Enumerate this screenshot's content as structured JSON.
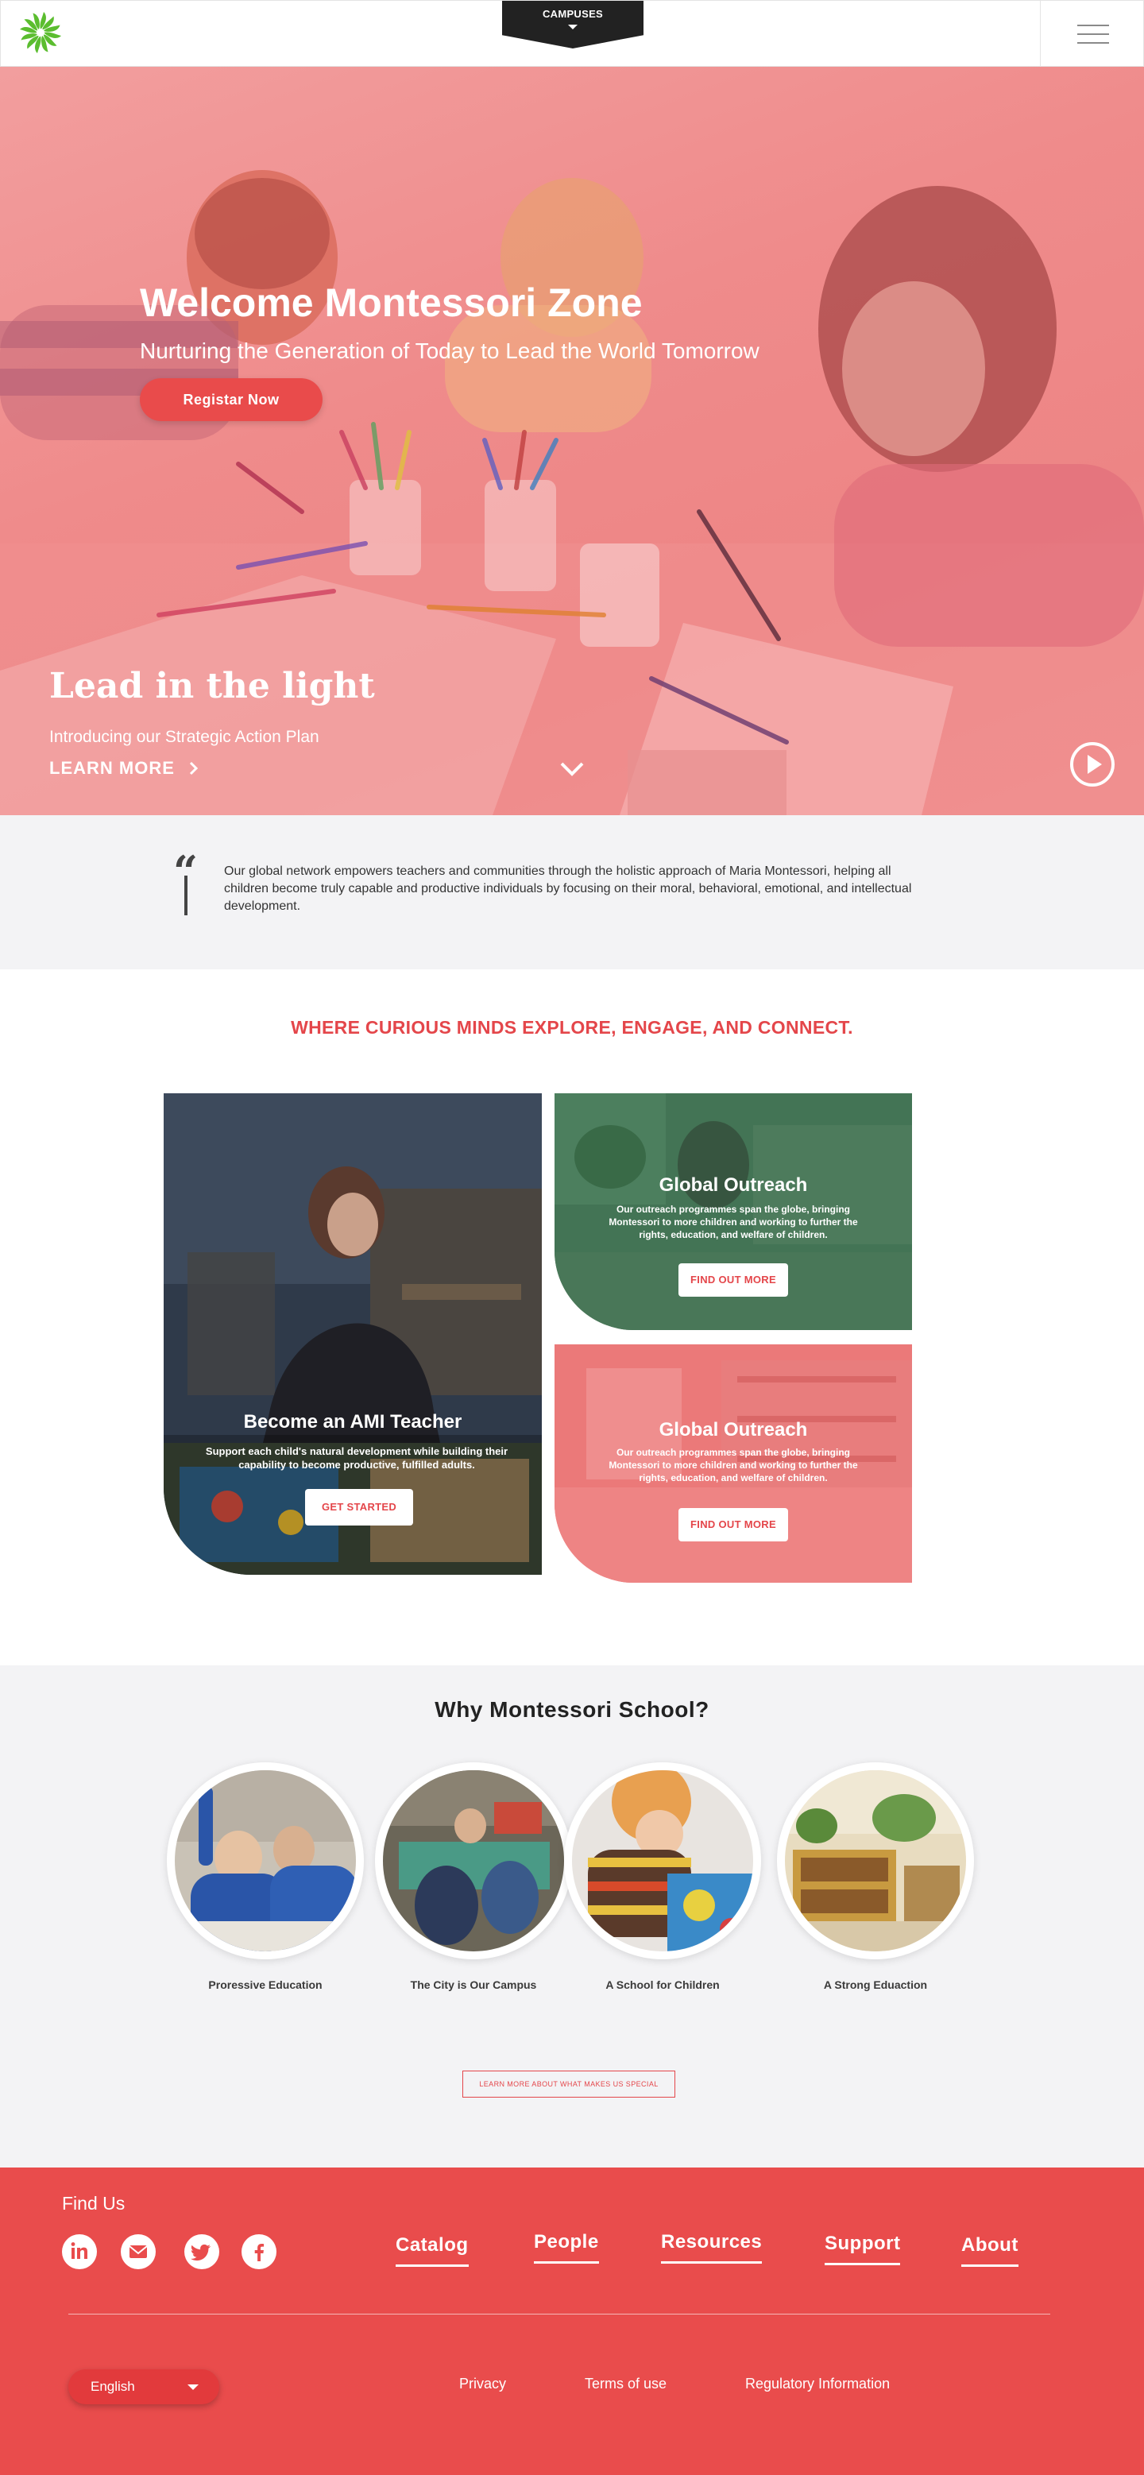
{
  "header": {
    "campuses_label": "CAMPUSES"
  },
  "hero": {
    "title": "Welcome Montessori Zone",
    "subtitle": "Nurturing the Generation of Today to Lead the World Tomorrow",
    "register_label": "Registar Now",
    "lead_title": "Lead in the light",
    "intro_text": "Introducing our Strategic Action Plan",
    "learn_more_label": "LEARN MORE"
  },
  "quote": {
    "mark": "“",
    "text": "Our global network empowers teachers and communities through the holistic approach of Maria Montessori, helping all children become truly capable and productive individuals by focusing on their moral, behavioral, emotional, and intellectual development."
  },
  "tagline": "WHERE CURIOUS MINDS EXPLORE, ENGAGE, AND CONNECT.",
  "cards": {
    "ami": {
      "title": "Become an AMI Teacher",
      "text": "Support each child's natural development while building their capability to become productive, fulfilled adults.",
      "button": "GET STARTED"
    },
    "outreach1": {
      "title": "Global Outreach",
      "text": "Our outreach programmes span the globe, bringing Montessori to more children and working to further the rights, education, and welfare of children.",
      "button": "FIND OUT MORE"
    },
    "outreach2": {
      "title": "Global Outreach",
      "text": "Our outreach programmes span the globe, bringing Montessori to more children and working to further the rights, education, and welfare of children.",
      "button": "FIND OUT MORE"
    }
  },
  "why": {
    "title": "Why Montessori School?",
    "items": [
      {
        "label": "Proressive Education"
      },
      {
        "label": "The City is Our Campus"
      },
      {
        "label": "A School for Children"
      },
      {
        "label": "A Strong Eduaction"
      }
    ],
    "button": "LEARN MORE ABOUT WHAT MAKES US SPECIAL"
  },
  "footer": {
    "find_us": "Find Us",
    "social_icons": [
      "linkedin-icon",
      "mail-icon",
      "twitter-icon",
      "facebook-icon"
    ],
    "nav": [
      "Catalog",
      "People",
      "Resources",
      "Support",
      "About"
    ],
    "language": "English",
    "links": [
      "Privacy",
      "Terms of use",
      "Regulatory Information"
    ]
  },
  "colors": {
    "brand_red": "#e94c4c",
    "tagline_red": "#e4464a",
    "logo_green": "#5bbd2f",
    "hero_overlay": "#ef8b8b"
  }
}
